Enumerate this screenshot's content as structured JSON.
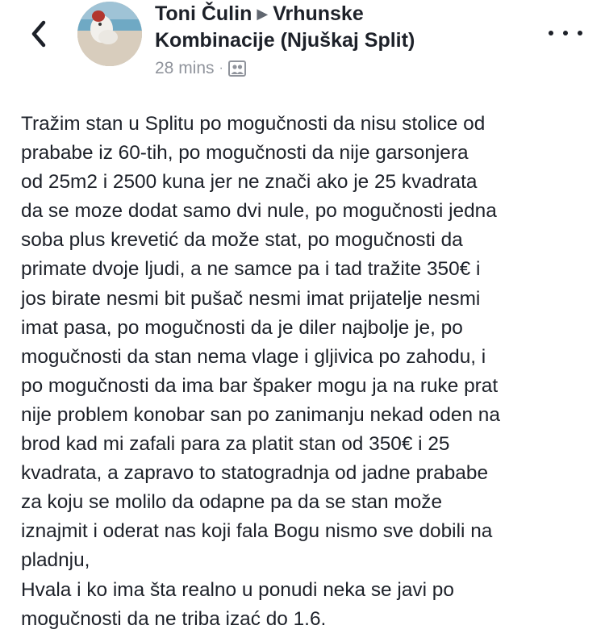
{
  "header": {
    "author": "Toni Čulin",
    "group_line1": "Vrhunske",
    "group_line2": "Kombinacije (Njuškaj Split)",
    "time": "28 mins",
    "separator": "·",
    "icons": {
      "back": "chevron-left-icon",
      "audience": "group-icon",
      "more": "more-dots-icon",
      "arrow": "right-triangle-icon"
    }
  },
  "post": {
    "text": "Tražim stan u Splitu po mogučnosti da nisu stolice od\nprababe iz 60-tih, po mogučnosti da nije garsonjera\nod 25m2 i 2500 kuna jer ne znači ako je 25 kvadrata\nda se moze dodat samo dvi nule, po mogučnosti jedna\nsoba plus krevetić da može stat, po mogučnosti da\nprimate dvoje ljudi, a ne samce pa i tad tražite 350€ i\njos birate nesmi bit pušač nesmi imat prijatelje nesmi\nimat pasa, po mogučnosti da je diler najbolje je, po\nmogučnosti da stan nema vlage i gljivica po zahodu, i\npo mogučnosti da ima bar špaker mogu ja na ruke prat\nnije problem konobar san po zanimanju nekad oden na\nbrod kad mi zafali para za platit stan od 350€ i 25\nkvadrata, a zapravo to statogradnja od jadne prababe\nza koju se molilo da odapne pa da se stan može\niznajmit i oderat nas koji fala Bogu nismo sve dobili na\npladnju,\nHvala i ko ima šta realno u ponudi neka se javi po\nmogučnosti da ne triba izać do 1.6."
  },
  "colors": {
    "text": "#1d2129",
    "meta": "#90949c",
    "background": "#ffffff"
  }
}
